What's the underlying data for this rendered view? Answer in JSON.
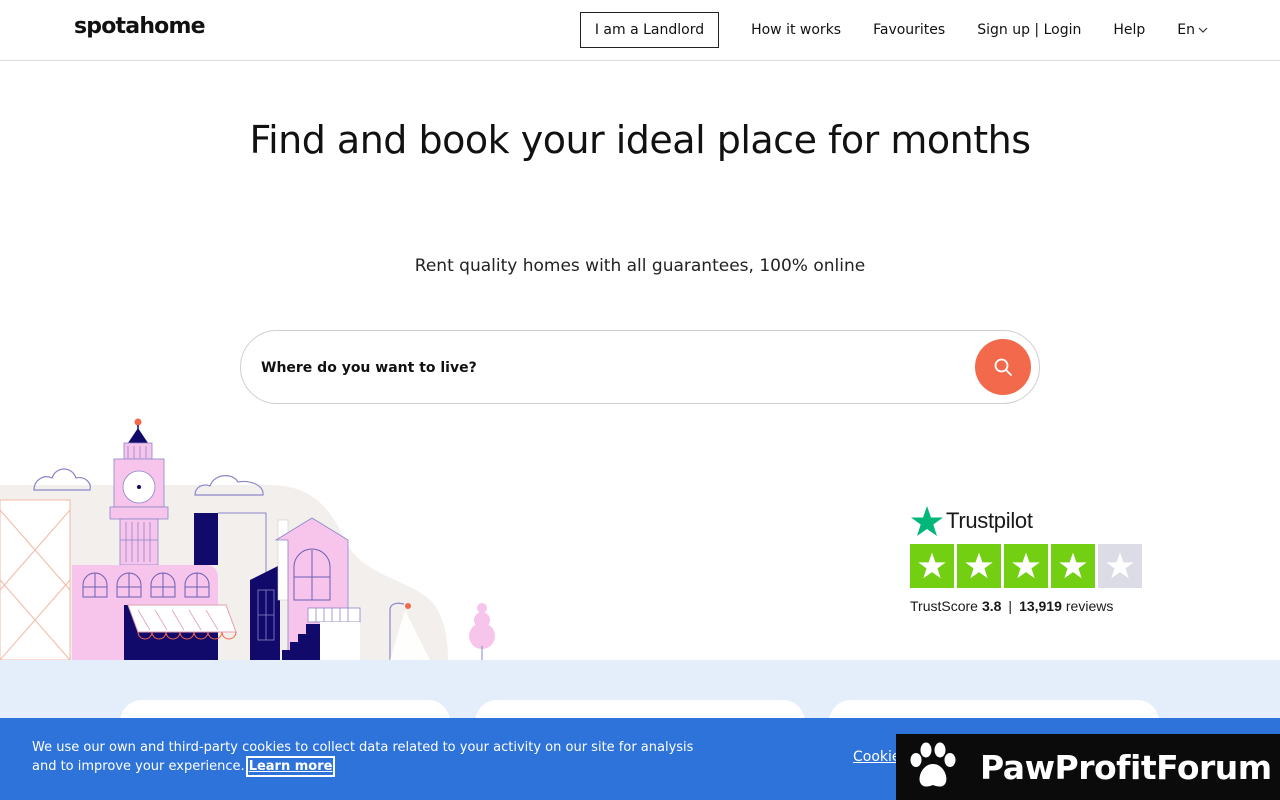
{
  "header": {
    "logo": "spotahome",
    "landlord_button": "I am a Landlord",
    "nav": [
      "How it works",
      "Favourites",
      "Sign up | Login",
      "Help"
    ],
    "language": "En"
  },
  "hero": {
    "title": "Find and book your ideal place for months",
    "subtitle": "Rent quality homes with all guarantees, 100% online"
  },
  "search": {
    "placeholder": "Where do you want to live?"
  },
  "trustpilot": {
    "brand": "Trustpilot",
    "score_label": "TrustScore",
    "score": "3.8",
    "reviews_count": "13,919",
    "reviews_label": "reviews",
    "stars_filled": 4,
    "stars_total": 5
  },
  "cookie": {
    "text": "We use our own and third-party cookies to collect data related to your activity on our site for analysis and to improve your experience.",
    "learn_more": "Learn more",
    "settings": "Cookie"
  },
  "watermark": {
    "text": "PawProfitForum"
  },
  "colors": {
    "accent": "#f26a4b",
    "cookie_bg": "#2e73d9",
    "band_bg": "#e4eefa",
    "trust_green": "#73cf11",
    "trust_gray": "#dcdce6",
    "illustration_pink": "#f7c4ec",
    "illustration_navy": "#120a6b"
  }
}
